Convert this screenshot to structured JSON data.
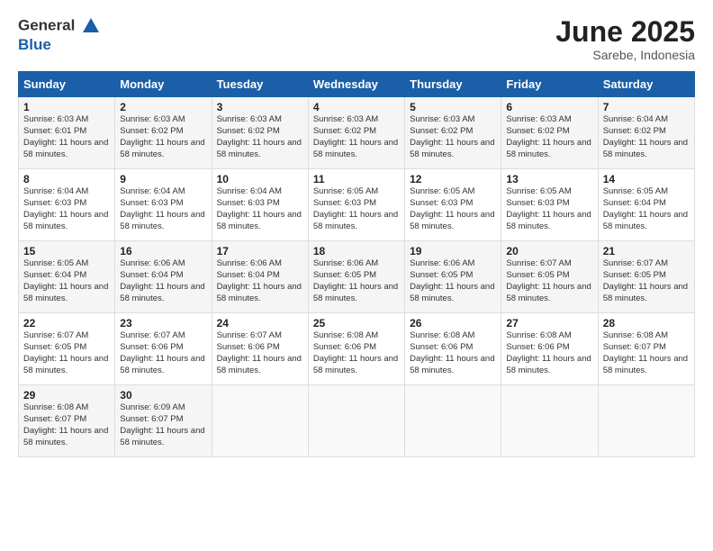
{
  "logo": {
    "general": "General",
    "blue": "Blue"
  },
  "title": "June 2025",
  "location": "Sarebe, Indonesia",
  "days_header": [
    "Sunday",
    "Monday",
    "Tuesday",
    "Wednesday",
    "Thursday",
    "Friday",
    "Saturday"
  ],
  "weeks": [
    [
      {
        "day": "1",
        "sunrise": "6:03 AM",
        "sunset": "6:01 PM",
        "daylight": "11 hours and 58 minutes."
      },
      {
        "day": "2",
        "sunrise": "6:03 AM",
        "sunset": "6:02 PM",
        "daylight": "11 hours and 58 minutes."
      },
      {
        "day": "3",
        "sunrise": "6:03 AM",
        "sunset": "6:02 PM",
        "daylight": "11 hours and 58 minutes."
      },
      {
        "day": "4",
        "sunrise": "6:03 AM",
        "sunset": "6:02 PM",
        "daylight": "11 hours and 58 minutes."
      },
      {
        "day": "5",
        "sunrise": "6:03 AM",
        "sunset": "6:02 PM",
        "daylight": "11 hours and 58 minutes."
      },
      {
        "day": "6",
        "sunrise": "6:03 AM",
        "sunset": "6:02 PM",
        "daylight": "11 hours and 58 minutes."
      },
      {
        "day": "7",
        "sunrise": "6:04 AM",
        "sunset": "6:02 PM",
        "daylight": "11 hours and 58 minutes."
      }
    ],
    [
      {
        "day": "8",
        "sunrise": "6:04 AM",
        "sunset": "6:03 PM",
        "daylight": "11 hours and 58 minutes."
      },
      {
        "day": "9",
        "sunrise": "6:04 AM",
        "sunset": "6:03 PM",
        "daylight": "11 hours and 58 minutes."
      },
      {
        "day": "10",
        "sunrise": "6:04 AM",
        "sunset": "6:03 PM",
        "daylight": "11 hours and 58 minutes."
      },
      {
        "day": "11",
        "sunrise": "6:05 AM",
        "sunset": "6:03 PM",
        "daylight": "11 hours and 58 minutes."
      },
      {
        "day": "12",
        "sunrise": "6:05 AM",
        "sunset": "6:03 PM",
        "daylight": "11 hours and 58 minutes."
      },
      {
        "day": "13",
        "sunrise": "6:05 AM",
        "sunset": "6:03 PM",
        "daylight": "11 hours and 58 minutes."
      },
      {
        "day": "14",
        "sunrise": "6:05 AM",
        "sunset": "6:04 PM",
        "daylight": "11 hours and 58 minutes."
      }
    ],
    [
      {
        "day": "15",
        "sunrise": "6:05 AM",
        "sunset": "6:04 PM",
        "daylight": "11 hours and 58 minutes."
      },
      {
        "day": "16",
        "sunrise": "6:06 AM",
        "sunset": "6:04 PM",
        "daylight": "11 hours and 58 minutes."
      },
      {
        "day": "17",
        "sunrise": "6:06 AM",
        "sunset": "6:04 PM",
        "daylight": "11 hours and 58 minutes."
      },
      {
        "day": "18",
        "sunrise": "6:06 AM",
        "sunset": "6:05 PM",
        "daylight": "11 hours and 58 minutes."
      },
      {
        "day": "19",
        "sunrise": "6:06 AM",
        "sunset": "6:05 PM",
        "daylight": "11 hours and 58 minutes."
      },
      {
        "day": "20",
        "sunrise": "6:07 AM",
        "sunset": "6:05 PM",
        "daylight": "11 hours and 58 minutes."
      },
      {
        "day": "21",
        "sunrise": "6:07 AM",
        "sunset": "6:05 PM",
        "daylight": "11 hours and 58 minutes."
      }
    ],
    [
      {
        "day": "22",
        "sunrise": "6:07 AM",
        "sunset": "6:05 PM",
        "daylight": "11 hours and 58 minutes."
      },
      {
        "day": "23",
        "sunrise": "6:07 AM",
        "sunset": "6:06 PM",
        "daylight": "11 hours and 58 minutes."
      },
      {
        "day": "24",
        "sunrise": "6:07 AM",
        "sunset": "6:06 PM",
        "daylight": "11 hours and 58 minutes."
      },
      {
        "day": "25",
        "sunrise": "6:08 AM",
        "sunset": "6:06 PM",
        "daylight": "11 hours and 58 minutes."
      },
      {
        "day": "26",
        "sunrise": "6:08 AM",
        "sunset": "6:06 PM",
        "daylight": "11 hours and 58 minutes."
      },
      {
        "day": "27",
        "sunrise": "6:08 AM",
        "sunset": "6:06 PM",
        "daylight": "11 hours and 58 minutes."
      },
      {
        "day": "28",
        "sunrise": "6:08 AM",
        "sunset": "6:07 PM",
        "daylight": "11 hours and 58 minutes."
      }
    ],
    [
      {
        "day": "29",
        "sunrise": "6:08 AM",
        "sunset": "6:07 PM",
        "daylight": "11 hours and 58 minutes."
      },
      {
        "day": "30",
        "sunrise": "6:09 AM",
        "sunset": "6:07 PM",
        "daylight": "11 hours and 58 minutes."
      },
      null,
      null,
      null,
      null,
      null
    ]
  ]
}
